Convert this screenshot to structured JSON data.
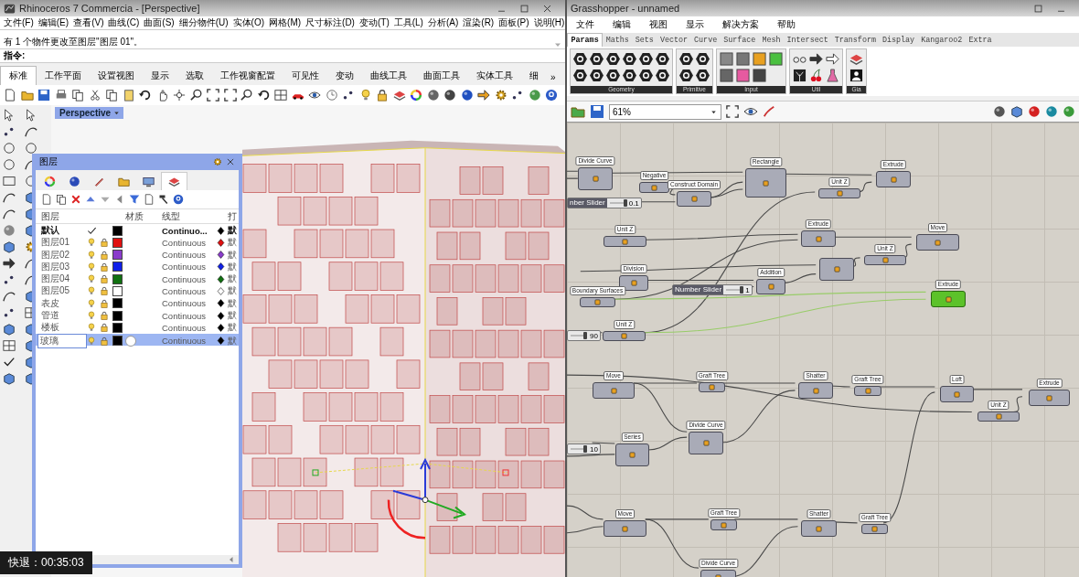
{
  "rhino": {
    "title": "Rhinoceros 7 Commercia - [Perspective]",
    "menu": [
      "文件(F)",
      "编辑(E)",
      "查看(V)",
      "曲线(C)",
      "曲面(S)",
      "细分物件(U)",
      "实体(O)",
      "网格(M)",
      "尺寸标注(D)",
      "变动(T)",
      "工具(L)",
      "分析(A)",
      "渲染(R)",
      "面板(P)",
      "说明(H)"
    ],
    "history": "有 1 个物件更改至图层\"图层 01\"。",
    "command_prompt": "指令:",
    "tabs": [
      {
        "label": "标准",
        "selected": true
      },
      {
        "label": "工作平面",
        "selected": false
      },
      {
        "label": "设置视图",
        "selected": false
      },
      {
        "label": "显示",
        "selected": false
      },
      {
        "label": "选取",
        "selected": false
      },
      {
        "label": "工作视窗配置",
        "selected": false
      },
      {
        "label": "可见性",
        "selected": false
      },
      {
        "label": "变动",
        "selected": false
      },
      {
        "label": "曲线工具",
        "selected": false
      },
      {
        "label": "曲面工具",
        "selected": false
      },
      {
        "label": "实体工具",
        "selected": false
      },
      {
        "label": "细",
        "selected": false
      }
    ],
    "tabs_more": "»",
    "viewport_label": "Perspective",
    "layers": {
      "title": "图层",
      "columns": [
        "图层",
        "材质",
        "线型",
        "打"
      ],
      "rows": [
        {
          "name": "默认",
          "current": true,
          "color": "#000000",
          "material": false,
          "linetype": "Continuo...",
          "print": "默",
          "selected": false
        },
        {
          "name": "图层01",
          "current": false,
          "color": "#e01010",
          "material": false,
          "linetype": "Continuous",
          "print": "默",
          "selected": false
        },
        {
          "name": "图层02",
          "current": false,
          "color": "#8a3ccc",
          "material": false,
          "linetype": "Continuous",
          "print": "默",
          "selected": false
        },
        {
          "name": "图层03",
          "current": false,
          "color": "#1020e8",
          "material": false,
          "linetype": "Continuous",
          "print": "默",
          "selected": false
        },
        {
          "name": "图层04",
          "current": false,
          "color": "#107010",
          "material": false,
          "linetype": "Continuous",
          "print": "默",
          "selected": false
        },
        {
          "name": "图层05",
          "current": false,
          "color": "#ffffff",
          "material": false,
          "linetype": "Continuous",
          "print": "默",
          "selected": false
        },
        {
          "name": "表皮",
          "current": false,
          "color": "#000000",
          "material": false,
          "linetype": "Continuous",
          "print": "默",
          "selected": false
        },
        {
          "name": "管道",
          "current": false,
          "color": "#000000",
          "material": false,
          "linetype": "Continuous",
          "print": "默",
          "selected": false
        },
        {
          "name": "楼板",
          "current": false,
          "color": "#000000",
          "material": false,
          "linetype": "Continuous",
          "print": "默",
          "selected": false
        },
        {
          "name": "玻璃",
          "current": false,
          "color": "#000000",
          "material": true,
          "linetype": "Continuous",
          "print": "默",
          "selected": true
        }
      ]
    }
  },
  "overlay": "快退：00:35:03",
  "grasshopper": {
    "title": "Grasshopper - unnamed",
    "menu": [
      "文件",
      "编辑",
      "视图",
      "显示",
      "解决方案",
      "帮助"
    ],
    "tabs": [
      {
        "label": "Params",
        "selected": true
      },
      {
        "label": "Maths",
        "selected": false
      },
      {
        "label": "Sets",
        "selected": false
      },
      {
        "label": "Vector",
        "selected": false
      },
      {
        "label": "Curve",
        "selected": false
      },
      {
        "label": "Surface",
        "selected": false
      },
      {
        "label": "Mesh",
        "selected": false
      },
      {
        "label": "Intersect",
        "selected": false
      },
      {
        "label": "Transform",
        "selected": false
      },
      {
        "label": "Display",
        "selected": false
      },
      {
        "label": "Kangaroo2",
        "selected": false
      },
      {
        "label": "Extra",
        "selected": false
      }
    ],
    "groups": [
      "Geometry",
      "Primitive",
      "Input",
      "Util",
      "Gia"
    ],
    "zoom": "61%",
    "nodes": [
      {
        "kind": "component",
        "name": "Divide Curve",
        "selected": false
      },
      {
        "kind": "component",
        "name": "Negative",
        "selected": false
      },
      {
        "kind": "component",
        "name": "Construct Domain",
        "selected": false
      },
      {
        "kind": "component",
        "name": "Rectangle",
        "selected": false
      },
      {
        "kind": "component",
        "name": "Unit Z",
        "selected": false
      },
      {
        "kind": "component",
        "name": "Extrude",
        "selected": false
      },
      {
        "kind": "slider",
        "name": "nber Slider",
        "value": "0.1",
        "level": 0.95
      },
      {
        "kind": "component",
        "name": "Unit Z",
        "selected": false
      },
      {
        "kind": "component",
        "name": "Extrude",
        "selected": false
      },
      {
        "kind": "component",
        "name": "Move",
        "selected": false
      },
      {
        "kind": "component",
        "selected": false
      },
      {
        "kind": "component",
        "name": "Unit Z",
        "selected": false
      },
      {
        "kind": "component",
        "name": "Division",
        "selected": false
      },
      {
        "kind": "component",
        "name": "Boundary Surfaces",
        "selected": false
      },
      {
        "kind": "slider",
        "name": "Number Slider",
        "value": "1",
        "level": 0.95
      },
      {
        "kind": "component",
        "name": "Addition",
        "selected": false
      },
      {
        "kind": "component",
        "name": "Extrude",
        "selected": true
      },
      {
        "kind": "component",
        "name": "Unit Z",
        "selected": false
      },
      {
        "kind": "slider",
        "value": "90",
        "level": 0.9
      },
      {
        "kind": "component",
        "name": "Move",
        "selected": false
      },
      {
        "kind": "component",
        "name": "Graft Tree",
        "selected": false
      },
      {
        "kind": "component",
        "name": "Shatter",
        "selected": false
      },
      {
        "kind": "component",
        "name": "Graft Tree",
        "selected": false
      },
      {
        "kind": "component",
        "name": "Loft",
        "selected": false
      },
      {
        "kind": "component",
        "name": "Extrude",
        "selected": false
      },
      {
        "kind": "component",
        "name": "Unit Z",
        "selected": false
      },
      {
        "kind": "component",
        "name": "Divide Curve",
        "selected": false
      },
      {
        "kind": "component",
        "name": "Series",
        "selected": false
      },
      {
        "kind": "slider",
        "value": "10",
        "level": 0.9
      },
      {
        "kind": "component",
        "name": "Move",
        "selected": false
      },
      {
        "kind": "component",
        "name": "Graft Tree",
        "selected": false
      },
      {
        "kind": "component",
        "name": "Shatter",
        "selected": false
      },
      {
        "kind": "component",
        "name": "Graft Tree",
        "selected": false
      },
      {
        "kind": "component",
        "name": "Divide Curve",
        "selected": false
      }
    ]
  }
}
